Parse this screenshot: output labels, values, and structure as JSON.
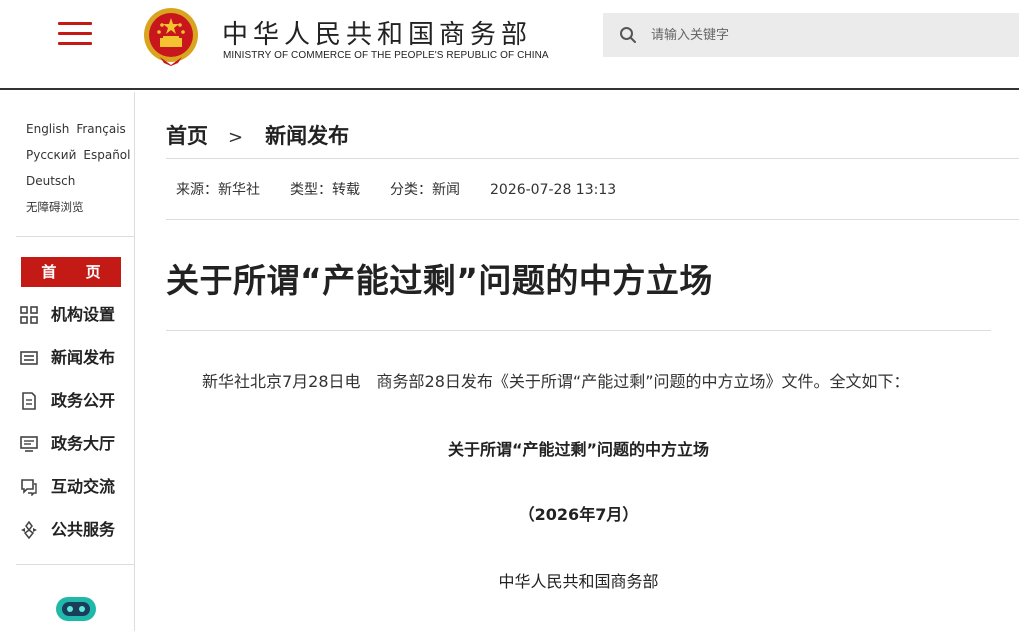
{
  "header": {
    "site_title": "中华人民共和国商务部",
    "site_subtitle": "MINISTRY OF COMMERCE OF THE PEOPLE'S REPUBLIC OF CHINA",
    "search_placeholder": "请输入关键字",
    "accent_color": "#c41a16"
  },
  "sidebar": {
    "languages": [
      [
        "English",
        "Français"
      ],
      [
        "Русский",
        "Español"
      ],
      [
        "Deutsch"
      ],
      [
        "无障碍浏览"
      ]
    ],
    "home_label": "首 页",
    "nav": [
      {
        "label": "机构设置",
        "icon": "grid-icon"
      },
      {
        "label": "新闻发布",
        "icon": "news-icon"
      },
      {
        "label": "政务公开",
        "icon": "document-icon"
      },
      {
        "label": "政务大厅",
        "icon": "hall-icon"
      },
      {
        "label": "互动交流",
        "icon": "chat-icon"
      },
      {
        "label": "公共服务",
        "icon": "service-icon"
      }
    ],
    "assistant_icon": "robot-icon"
  },
  "breadcrumb": {
    "home": "首页",
    "separator": ">",
    "current": "新闻发布"
  },
  "meta": {
    "source": "来源：新华社",
    "type": "类型：转载",
    "category": "分类：新闻",
    "datetime": "2026-07-28 13:13"
  },
  "article": {
    "title": "关于所谓“产能过剩”问题的中方立场",
    "lead_part1": "新华社北京7月28日电",
    "lead_part2": "商务部28日发布《关于所谓“产能过剩”问题的中方立场》文件。全文如下：",
    "doc_title": "关于所谓“产能过剩”问题的中方立场",
    "doc_date": "（2026年7月）",
    "doc_issuer": "中华人民共和国商务部"
  }
}
